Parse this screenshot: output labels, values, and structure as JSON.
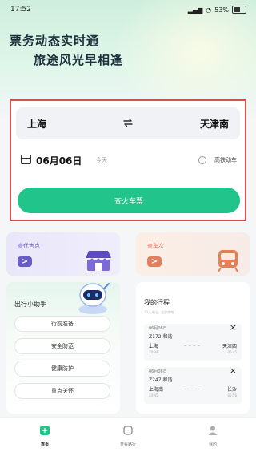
{
  "status": {
    "time": "17:52",
    "battery": "53%"
  },
  "hero": {
    "line1": "票务动态实时通",
    "line2": "旅途风光早相逢"
  },
  "search": {
    "from": "上海",
    "to": "天津南",
    "date": "06月06日",
    "today": "今天",
    "high_speed_label": "高铁动车",
    "button_label": "查火车票"
  },
  "tiles": [
    {
      "label": "查代售点",
      "arrow": ">"
    },
    {
      "label": "查车次",
      "arrow": ">"
    }
  ],
  "assistant": {
    "title": "出行小助手",
    "items": [
      "行前准备",
      "安全防范",
      "健康防护",
      "重点关怀"
    ]
  },
  "itinerary": {
    "title": "我的行程",
    "subtitle": "10天未出，全部缩略",
    "trips": [
      {
        "date": "06月06日",
        "train": "Z172 和谐",
        "from": "上海",
        "to": "天津西",
        "from_time": "16:34",
        "to_time": "06:45"
      },
      {
        "date": "06月06日",
        "train": "Z247 和谐",
        "from": "上海南",
        "to": "长沙",
        "from_time": "20:45",
        "to_time": "06:56"
      }
    ]
  },
  "tabs": [
    {
      "label": "首页",
      "active": true
    },
    {
      "label": "查看路行",
      "active": false
    },
    {
      "label": "我的",
      "active": false
    }
  ],
  "colors": {
    "accent": "#21c48b",
    "highlight_border": "#d84d4d"
  }
}
